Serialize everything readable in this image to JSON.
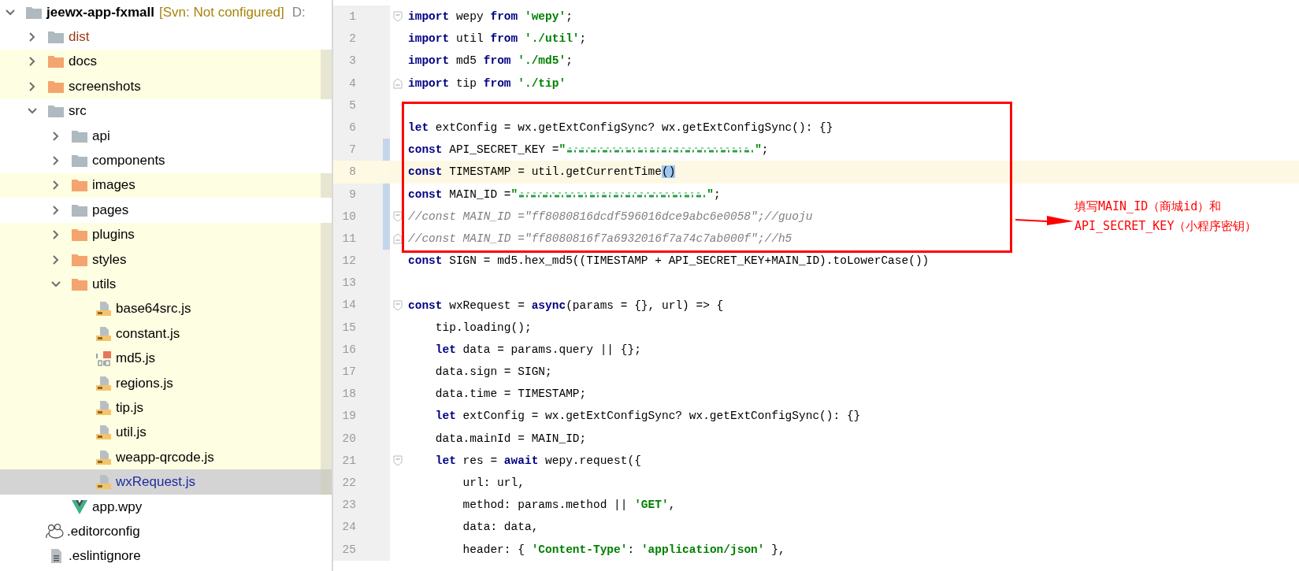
{
  "tree": {
    "root": {
      "name": "jeewx-app-fxmall",
      "vcs_note": "[Svn: Not configured]",
      "path": "D:",
      "expanded": true,
      "children": [
        {
          "name": "dist",
          "kind": "folder",
          "expanded": false,
          "highlighted": false,
          "excluded": true,
          "selected": false
        },
        {
          "name": "docs",
          "kind": "folder",
          "expanded": false,
          "highlighted": true,
          "excluded": false,
          "selected": false
        },
        {
          "name": "screenshots",
          "kind": "folder",
          "expanded": false,
          "highlighted": true,
          "excluded": false,
          "selected": false
        },
        {
          "name": "src",
          "kind": "folder",
          "expanded": true,
          "highlighted": false,
          "excluded": false,
          "selected": false,
          "children": [
            {
              "name": "api",
              "kind": "folder",
              "expanded": false,
              "highlighted": false,
              "excluded": false,
              "selected": false
            },
            {
              "name": "components",
              "kind": "folder",
              "expanded": false,
              "highlighted": false,
              "excluded": false,
              "selected": false
            },
            {
              "name": "images",
              "kind": "folder",
              "expanded": false,
              "highlighted": true,
              "excluded": false,
              "selected": false
            },
            {
              "name": "pages",
              "kind": "folder",
              "expanded": false,
              "highlighted": false,
              "excluded": false,
              "selected": false
            },
            {
              "name": "plugins",
              "kind": "folder",
              "expanded": false,
              "highlighted": true,
              "excluded": false,
              "selected": false
            },
            {
              "name": "styles",
              "kind": "folder",
              "expanded": false,
              "highlighted": true,
              "excluded": false,
              "selected": false
            },
            {
              "name": "utils",
              "kind": "folder",
              "expanded": true,
              "highlighted": true,
              "excluded": false,
              "selected": false,
              "children": [
                {
                  "name": "base64src.js",
                  "kind": "js",
                  "highlighted": true,
                  "excluded": false,
                  "selected": false
                },
                {
                  "name": "constant.js",
                  "kind": "js",
                  "highlighted": true,
                  "excluded": false,
                  "selected": false
                },
                {
                  "name": "md5.js",
                  "kind": "binary-js",
                  "highlighted": true,
                  "excluded": false,
                  "selected": false
                },
                {
                  "name": "regions.js",
                  "kind": "js",
                  "highlighted": true,
                  "excluded": false,
                  "selected": false
                },
                {
                  "name": "tip.js",
                  "kind": "js",
                  "highlighted": true,
                  "excluded": false,
                  "selected": false
                },
                {
                  "name": "util.js",
                  "kind": "js",
                  "highlighted": true,
                  "excluded": false,
                  "selected": false
                },
                {
                  "name": "weapp-qrcode.js",
                  "kind": "js",
                  "highlighted": true,
                  "excluded": false,
                  "selected": false
                },
                {
                  "name": "wxRequest.js",
                  "kind": "js",
                  "highlighted": true,
                  "excluded": false,
                  "selected": true
                }
              ]
            },
            {
              "name": "app.wpy",
              "kind": "vue",
              "highlighted": false,
              "excluded": false,
              "selected": false
            }
          ]
        },
        {
          "name": ".editorconfig",
          "kind": "config",
          "highlighted": false,
          "excluded": false,
          "selected": false
        },
        {
          "name": ".eslintignore",
          "kind": "text",
          "highlighted": false,
          "excluded": false,
          "selected": false
        }
      ]
    }
  },
  "editor": {
    "lines": [
      {
        "number": "1",
        "kind": "fold-start",
        "changed": false,
        "current": false,
        "segments": [
          {
            "kind": "kw",
            "text": "import"
          },
          {
            "kind": "plain",
            "text": " wepy "
          },
          {
            "kind": "kw",
            "text": "from"
          },
          {
            "kind": "str",
            "text": " 'wepy'"
          },
          {
            "kind": "plain",
            "text": ";"
          }
        ]
      },
      {
        "number": "2",
        "kind": "plain",
        "changed": false,
        "current": false,
        "segments": [
          {
            "kind": "kw",
            "text": "import"
          },
          {
            "kind": "plain",
            "text": " util "
          },
          {
            "kind": "kw",
            "text": "from"
          },
          {
            "kind": "str",
            "text": " './util'"
          },
          {
            "kind": "plain",
            "text": ";"
          }
        ]
      },
      {
        "number": "3",
        "kind": "plain",
        "changed": false,
        "current": false,
        "segments": [
          {
            "kind": "kw",
            "text": "import"
          },
          {
            "kind": "plain",
            "text": " md5 "
          },
          {
            "kind": "kw",
            "text": "from"
          },
          {
            "kind": "str",
            "text": " './md5'"
          },
          {
            "kind": "plain",
            "text": ";"
          }
        ]
      },
      {
        "number": "4",
        "kind": "fold-end",
        "changed": false,
        "current": false,
        "segments": [
          {
            "kind": "kw",
            "text": "import"
          },
          {
            "kind": "plain",
            "text": " tip "
          },
          {
            "kind": "kw",
            "text": "from"
          },
          {
            "kind": "str",
            "text": " './tip'"
          }
        ]
      },
      {
        "number": "5",
        "kind": "plain",
        "changed": false,
        "current": false
      },
      {
        "number": "6",
        "kind": "plain",
        "changed": false,
        "current": false,
        "segments": [
          {
            "kind": "kw",
            "text": "let"
          },
          {
            "kind": "plain",
            "text": " extConfig = wx.getExtConfigSync? wx.getExtConfigSync(): {}"
          }
        ]
      },
      {
        "number": "7",
        "kind": "plain",
        "changed": true,
        "current": false,
        "segments": [
          {
            "kind": "kw",
            "text": "const"
          },
          {
            "kind": "plain",
            "text": " API_SECRET_KEY ="
          },
          {
            "kind": "str",
            "text": "\""
          },
          {
            "kind": "redacted"
          },
          {
            "kind": "str",
            "text": "\""
          },
          {
            "kind": "plain",
            "text": ";"
          }
        ]
      },
      {
        "number": "8",
        "kind": "plain",
        "changed": false,
        "current": true,
        "segments": [
          {
            "kind": "kw",
            "text": "const"
          },
          {
            "kind": "plain",
            "text": " TIMESTAMP = util.getCurrentTime"
          },
          {
            "kind": "match",
            "text": "()"
          }
        ]
      },
      {
        "number": "9",
        "kind": "plain",
        "changed": true,
        "current": false,
        "segments": [
          {
            "kind": "kw",
            "text": "const"
          },
          {
            "kind": "plain",
            "text": " MAIN_ID ="
          },
          {
            "kind": "str",
            "text": "\""
          },
          {
            "kind": "redacted"
          },
          {
            "kind": "str",
            "text": "\""
          },
          {
            "kind": "plain",
            "text": ";"
          }
        ]
      },
      {
        "number": "10",
        "kind": "fold-start",
        "changed": true,
        "current": false,
        "segments": [
          {
            "kind": "comment",
            "text": "//const MAIN_ID =\"ff8080816dcdf596016dce9abc6e0058\";//guoju"
          }
        ]
      },
      {
        "number": "11",
        "kind": "fold-end",
        "changed": true,
        "current": false,
        "segments": [
          {
            "kind": "comment",
            "text": "//const MAIN_ID =\"ff8080816f7a6932016f7a74c7ab000f\";//h5"
          }
        ]
      },
      {
        "number": "12",
        "kind": "plain",
        "changed": false,
        "current": false,
        "segments": [
          {
            "kind": "kw",
            "text": "const"
          },
          {
            "kind": "plain",
            "text": " SIGN = md5.hex_md5((TIMESTAMP + API_SECRET_KEY+MAIN_ID).toLowerCase())"
          }
        ]
      },
      {
        "number": "13",
        "kind": "plain",
        "changed": false,
        "current": false
      },
      {
        "number": "14",
        "kind": "fold-start",
        "changed": false,
        "current": false,
        "segments": [
          {
            "kind": "kw",
            "text": "const"
          },
          {
            "kind": "plain",
            "text": " wxRequest = "
          },
          {
            "kind": "kw",
            "text": "async"
          },
          {
            "kind": "plain",
            "text": "(params = {}, url) => {"
          }
        ]
      },
      {
        "number": "15",
        "kind": "plain",
        "changed": false,
        "current": false,
        "segments": [
          {
            "kind": "plain",
            "text": "    tip.loading();"
          }
        ]
      },
      {
        "number": "16",
        "kind": "plain",
        "changed": false,
        "current": false,
        "segments": [
          {
            "kind": "kw",
            "text": "    let"
          },
          {
            "kind": "plain",
            "text": " data = params.query || {};"
          }
        ]
      },
      {
        "number": "17",
        "kind": "plain",
        "changed": false,
        "current": false,
        "segments": [
          {
            "kind": "plain",
            "text": "    data.sign = SIGN;"
          }
        ]
      },
      {
        "number": "18",
        "kind": "plain",
        "changed": false,
        "current": false,
        "segments": [
          {
            "kind": "plain",
            "text": "    data.time = TIMESTAMP;"
          }
        ]
      },
      {
        "number": "19",
        "kind": "plain",
        "changed": false,
        "current": false,
        "segments": [
          {
            "kind": "kw",
            "text": "    let"
          },
          {
            "kind": "plain",
            "text": " extConfig = wx.getExtConfigSync? wx.getExtConfigSync(): {}"
          }
        ]
      },
      {
        "number": "20",
        "kind": "plain",
        "changed": false,
        "current": false,
        "segments": [
          {
            "kind": "plain",
            "text": "    data.mainId = MAIN_ID;"
          }
        ]
      },
      {
        "number": "21",
        "kind": "fold-start",
        "changed": false,
        "current": false,
        "segments": [
          {
            "kind": "kw",
            "text": "    let"
          },
          {
            "kind": "plain",
            "text": " res = "
          },
          {
            "kind": "kw",
            "text": "await"
          },
          {
            "kind": "plain",
            "text": " wepy.request({"
          }
        ]
      },
      {
        "number": "22",
        "kind": "plain",
        "changed": false,
        "current": false,
        "segments": [
          {
            "kind": "plain",
            "text": "        url: url,"
          }
        ]
      },
      {
        "number": "23",
        "kind": "plain",
        "changed": false,
        "current": false,
        "segments": [
          {
            "kind": "plain",
            "text": "        method: params.method || "
          },
          {
            "kind": "str",
            "text": "'GET'"
          },
          {
            "kind": "plain",
            "text": ","
          }
        ]
      },
      {
        "number": "24",
        "kind": "plain",
        "changed": false,
        "current": false,
        "segments": [
          {
            "kind": "plain",
            "text": "        data: data,"
          }
        ]
      },
      {
        "number": "25",
        "kind": "plain",
        "changed": false,
        "current": false,
        "segments": [
          {
            "kind": "plain",
            "text": "        header: { "
          },
          {
            "kind": "str",
            "text": "'Content-Type'"
          },
          {
            "kind": "plain",
            "text": ": "
          },
          {
            "kind": "str",
            "text": "'application/json'"
          },
          {
            "kind": "plain",
            "text": " },"
          }
        ]
      }
    ]
  },
  "annotation": {
    "lines": [
      "填写MAIN_ID（商城id）和",
      "API_SECRET_KEY（小程序密钥）"
    ]
  }
}
